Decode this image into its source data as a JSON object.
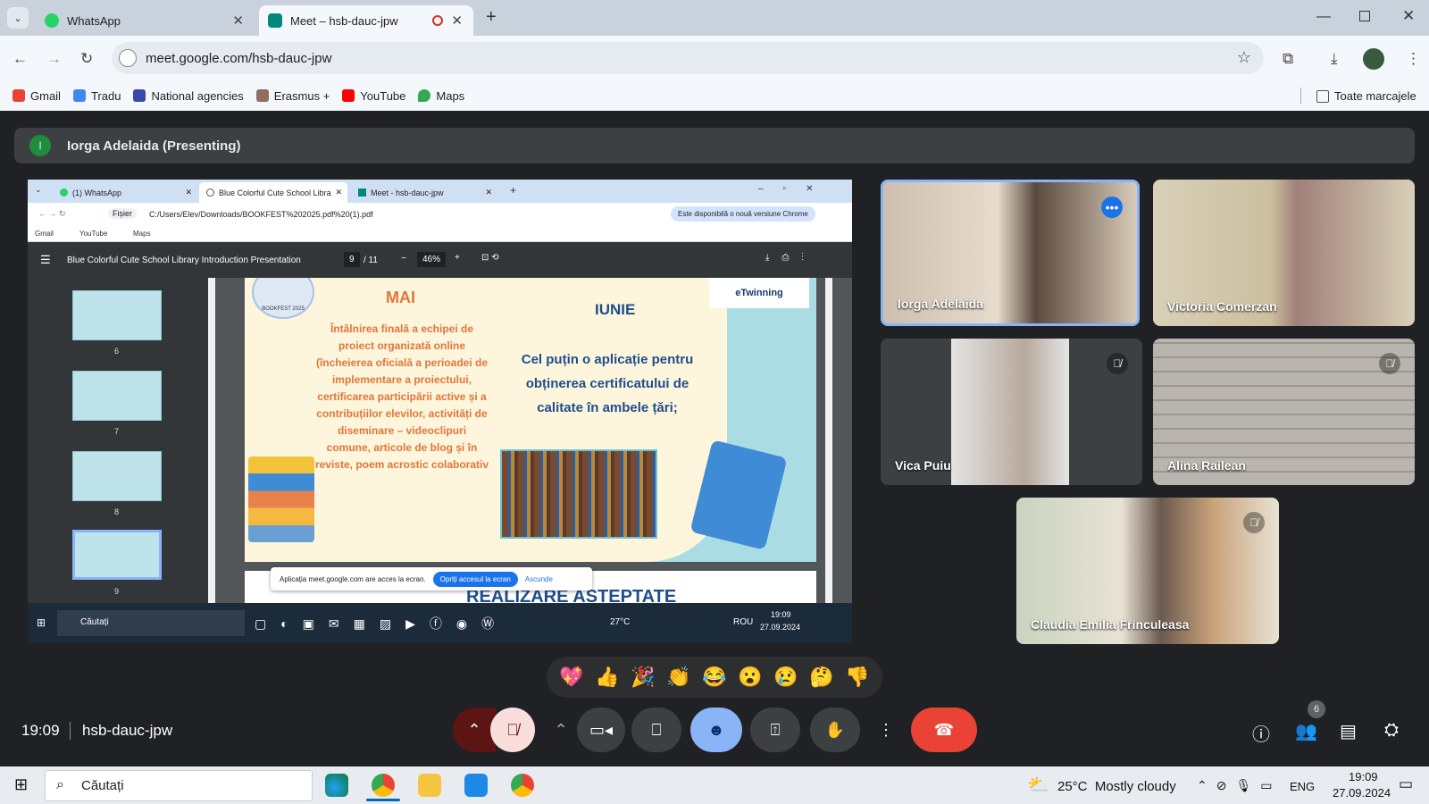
{
  "browser": {
    "tabs": [
      {
        "label": "WhatsApp",
        "active": false,
        "favicon_color": "#25d366"
      },
      {
        "label": "Meet – hsb-dauc-jpw",
        "active": true,
        "favicon_color": "#00897b"
      }
    ],
    "url": "meet.google.com/hsb-dauc-jpw",
    "bookmarks": [
      {
        "label": "Gmail",
        "color": "#ea4335"
      },
      {
        "label": "Tradu",
        "color": "#4285f4"
      },
      {
        "label": "National agencies",
        "color": "#3949ab"
      },
      {
        "label": "Erasmus +",
        "color": "#8d6e63"
      },
      {
        "label": "YouTube",
        "color": "#ff0000"
      },
      {
        "label": "Maps",
        "color": "#34a853"
      }
    ],
    "all_bookmarks": "Toate marcajele"
  },
  "meet": {
    "presenting_initial": "I",
    "presenting_banner": "Iorga Adelaida (Presenting)",
    "participants": [
      {
        "name": "Iorga Adelaida",
        "muted": false,
        "active_speaker": true
      },
      {
        "name": "Victoria Comerzan",
        "muted": false
      },
      {
        "name": "Vica Puiu",
        "muted": true
      },
      {
        "name": "Alina Railean",
        "muted": true
      },
      {
        "name": "Claudia Emilia Frinculeasa",
        "muted": true
      }
    ],
    "reactions": [
      "💖",
      "👍",
      "🎉",
      "👏",
      "😂",
      "😮",
      "😢",
      "🤔",
      "👎"
    ],
    "time": "19:09",
    "meeting_code": "hsb-dauc-jpw",
    "participant_count": "6"
  },
  "shared": {
    "tabs": [
      "(1) WhatsApp",
      "Blue Colorful Cute School Libra",
      "Meet - hsb-dauc-jpw"
    ],
    "url_prefix": "Fișier",
    "url": "C:/Users/Elev/Downloads/BOOKFEST%202025.pdf%20(1).pdf",
    "update_notice": "Este disponibilă o nouă versiune Chrome",
    "bookmarks": [
      "Gmail",
      "YouTube",
      "Maps"
    ],
    "pdf_title": "Blue Colorful Cute School Library Introduction Presentation",
    "page_current": "9",
    "page_total": "/ 11",
    "zoom": "46%",
    "thumb_numbers": [
      "6",
      "7",
      "8",
      "9"
    ],
    "slide": {
      "logo_left": "BOOKFEST 2025",
      "logo_right": "eTwinning",
      "col1_title": "MAI",
      "col1_text": "Întâlnirea finală a echipei de proiect organizată online (încheierea oficială a perioadei de implementare a proiectului, certificarea participării active și a contribuțiilor elevilor, activități de diseminare – videoclipuri comune, articole de blog și în reviste, poem acrostic colaborativ",
      "col2_title": "IUNIE",
      "col2_text": "Cel puțin o aplicație pentru obținerea certificatului de calitate în ambele țări;"
    },
    "next_slide_partial": "REALIZARE ASTEPTATE",
    "share_notice": "Aplicația meet.google.com are acces la ecran.",
    "stop_share": "Opriți accesul la ecran",
    "hide": "Ascunde",
    "taskbar_search": "Căutați",
    "taskbar_temp": "27°C",
    "taskbar_lang": "ROU",
    "taskbar_time": "19:09",
    "taskbar_date": "27.09.2024"
  },
  "windows": {
    "search": "Căutați",
    "weather": "25°C  Mostly cloudy",
    "lang": "ENG",
    "time": "19:09",
    "date": "27.09.2024"
  }
}
